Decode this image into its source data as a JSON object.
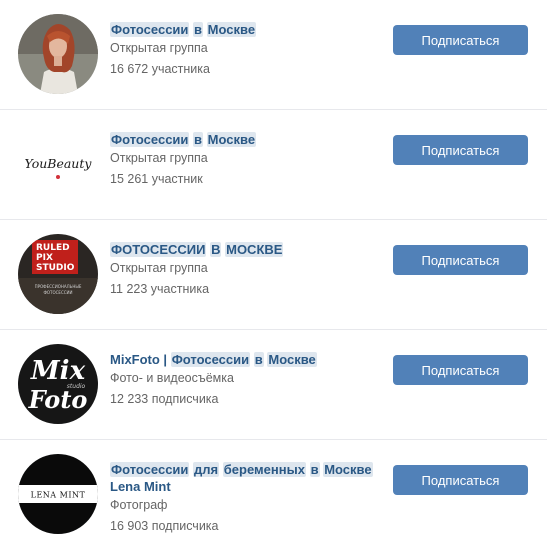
{
  "groups": [
    {
      "avatar_icon": "red-haired-woman-photo",
      "title_parts": [
        {
          "text": "Фотосессии",
          "hl": true
        },
        {
          "text": " "
        },
        {
          "text": "в",
          "hl": true
        },
        {
          "text": " "
        },
        {
          "text": "Москве",
          "hl": true
        }
      ],
      "type": "Открытая группа",
      "members": "16 672 участника",
      "button": "Подписаться"
    },
    {
      "avatar_icon": "you-beauty-logo",
      "logo_text": "YouBeauty",
      "title_parts": [
        {
          "text": "Фотосессии",
          "hl": true
        },
        {
          "text": " "
        },
        {
          "text": "в",
          "hl": true
        },
        {
          "text": " "
        },
        {
          "text": "Москве",
          "hl": true
        }
      ],
      "type": "Открытая группа",
      "members": "15 261 участник",
      "button": "Подписаться"
    },
    {
      "avatar_icon": "ruled-pix-studio-logo",
      "logo_text": [
        "RULED",
        "PIX",
        "STUDIO"
      ],
      "logo_subtext": [
        "ПРОФЕССИОНАЛЬНЫЕ",
        "ФОТОСЕССИИ"
      ],
      "title_parts": [
        {
          "text": "ФОТОСЕССИИ",
          "hl": true
        },
        {
          "text": " "
        },
        {
          "text": "В",
          "hl": true
        },
        {
          "text": " "
        },
        {
          "text": "МОСКВЕ",
          "hl": true
        }
      ],
      "type": "Открытая группа",
      "members": "11 223 участника",
      "button": "Подписаться"
    },
    {
      "avatar_icon": "mix-foto-logo",
      "logo_text": [
        "Mix",
        "studio",
        "Foto"
      ],
      "title_parts": [
        {
          "text": "MixFoto | "
        },
        {
          "text": "Фотосессии",
          "hl": true
        },
        {
          "text": " "
        },
        {
          "text": "в",
          "hl": true
        },
        {
          "text": " "
        },
        {
          "text": "Москве",
          "hl": true
        }
      ],
      "type": "Фото- и видеосъёмка",
      "members": "12 233 подписчика",
      "button": "Подписаться"
    },
    {
      "avatar_icon": "lena-mint-logo",
      "logo_text": "LENA MINT",
      "title_parts": [
        {
          "text": "Фотосессии",
          "hl": true
        },
        {
          "text": " "
        },
        {
          "text": "для",
          "hl": true
        },
        {
          "text": " "
        },
        {
          "text": "беременных",
          "hl": true
        },
        {
          "text": " "
        },
        {
          "text": "в",
          "hl": true
        },
        {
          "text": " "
        },
        {
          "text": "Москве",
          "hl": true
        },
        {
          "text": " Lena Mint"
        }
      ],
      "type": "Фотограф",
      "members": "16 903 подписчика",
      "button": "Подписаться"
    }
  ],
  "colors": {
    "button": "#5181b8",
    "link": "#2a5885",
    "highlight": "#dee6ee",
    "meta": "#656565",
    "divider": "#e7e8ec"
  }
}
